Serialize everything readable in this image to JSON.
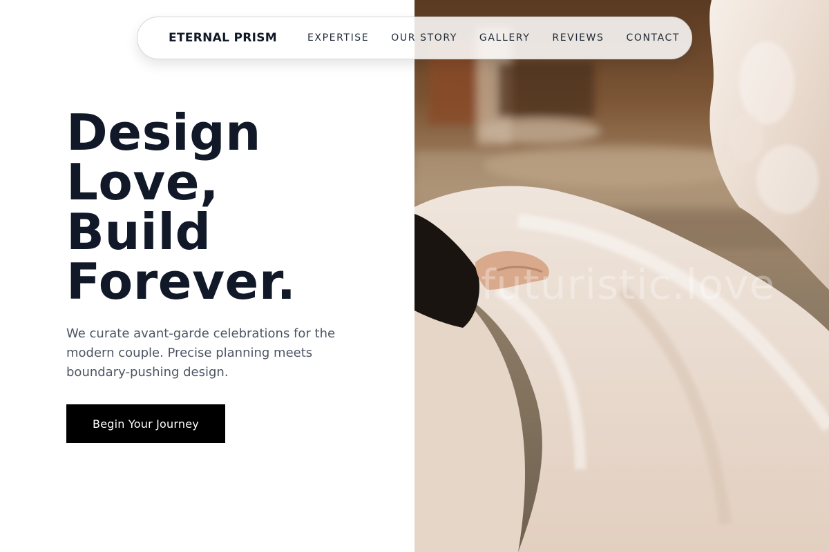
{
  "brand": "ETERNAL PRISM",
  "nav": {
    "items": [
      {
        "label": "EXPERTISE"
      },
      {
        "label": "OUR STORY"
      },
      {
        "label": "GALLERY"
      },
      {
        "label": "REVIEWS"
      },
      {
        "label": "CONTACT"
      }
    ]
  },
  "hero": {
    "headline_lines": [
      "Design",
      "Love,",
      "Build",
      "Forever."
    ],
    "subtext": "We curate avant-garde celebrations for the modern couple. Precise planning meets boundary-pushing design.",
    "cta_label": "Begin Your Journey"
  },
  "photo": {
    "watermark": "futuristic.love"
  },
  "colors": {
    "headline": "#111827",
    "subtext": "#4b5563",
    "cta_bg": "#000000",
    "cta_text": "#ffffff"
  }
}
